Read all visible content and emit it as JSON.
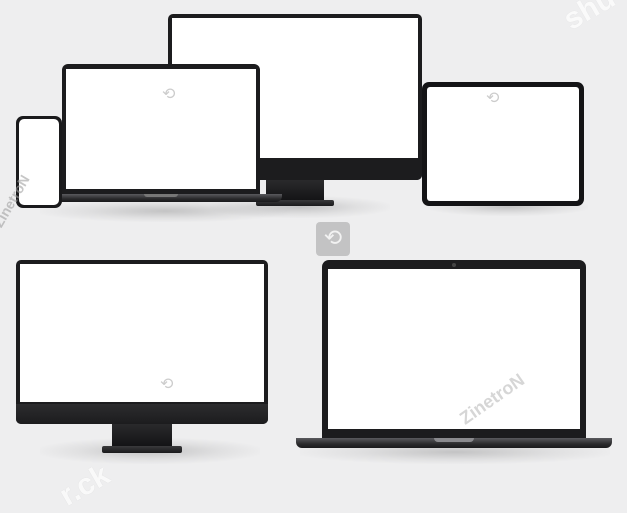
{
  "watermarks": {
    "top_right": "shu",
    "left_vertical": "ZinetroN",
    "bottom_right": "ZinetroN",
    "bottom_left": "r.ck",
    "logo_glyph": "⟲"
  },
  "devices": [
    {
      "name": "imac-top",
      "type": "desktop-monitor"
    },
    {
      "name": "laptop-top-left",
      "type": "laptop"
    },
    {
      "name": "phone",
      "type": "smartphone"
    },
    {
      "name": "tablet",
      "type": "tablet"
    },
    {
      "name": "imac-bottom-left",
      "type": "desktop-monitor"
    },
    {
      "name": "laptop-bottom-right",
      "type": "laptop"
    }
  ],
  "colors": {
    "background": "#eeeeef",
    "bezel": "#1c1c1e",
    "screen": "#ffffff"
  }
}
